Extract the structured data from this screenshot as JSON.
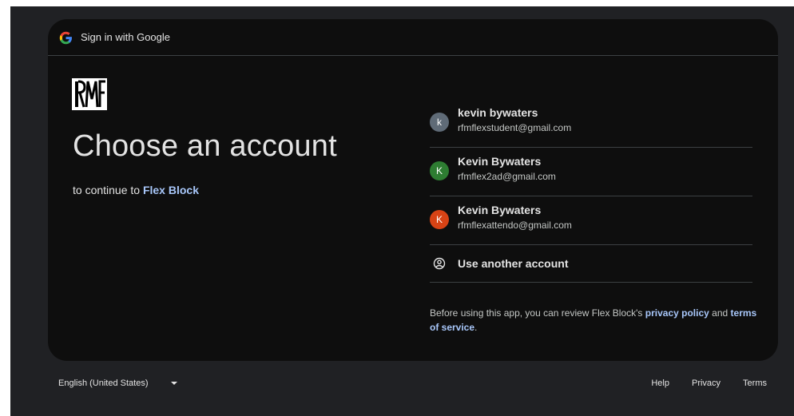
{
  "header": {
    "title": "Sign in with Google",
    "icon": "google-g-icon"
  },
  "branding": {
    "logo": "rmf-logo-icon"
  },
  "main": {
    "title": "Choose an account",
    "continue_prefix": "to continue to",
    "app_name": "Flex Block"
  },
  "accounts": [
    {
      "initial": "k",
      "name": "kevin bywaters",
      "email": "rfmflexstudent@gmail.com",
      "color": "#5f6b77"
    },
    {
      "initial": "K",
      "name": "Kevin Bywaters",
      "email": "rfmflex2ad@gmail.com",
      "color": "#2e7d32"
    },
    {
      "initial": "K",
      "name": "Kevin Bywaters",
      "email": "rfmflexattendo@gmail.com",
      "color": "#d84315"
    }
  ],
  "use_another": {
    "label": "Use another account",
    "icon": "account-circle-icon"
  },
  "policy": {
    "prefix": "Before using this app, you can review Flex Block's",
    "privacy_link": "privacy policy",
    "and": "and",
    "terms_link": "terms of service",
    "suffix": "."
  },
  "footer": {
    "language": "English (United States)",
    "help": "Help",
    "privacy": "Privacy",
    "terms": "Terms"
  },
  "colors": {
    "background": "#202124",
    "card": "#0e0e0e",
    "text": "#e3e3e3",
    "link": "#a8c7fa",
    "divider": "#3c4043"
  }
}
